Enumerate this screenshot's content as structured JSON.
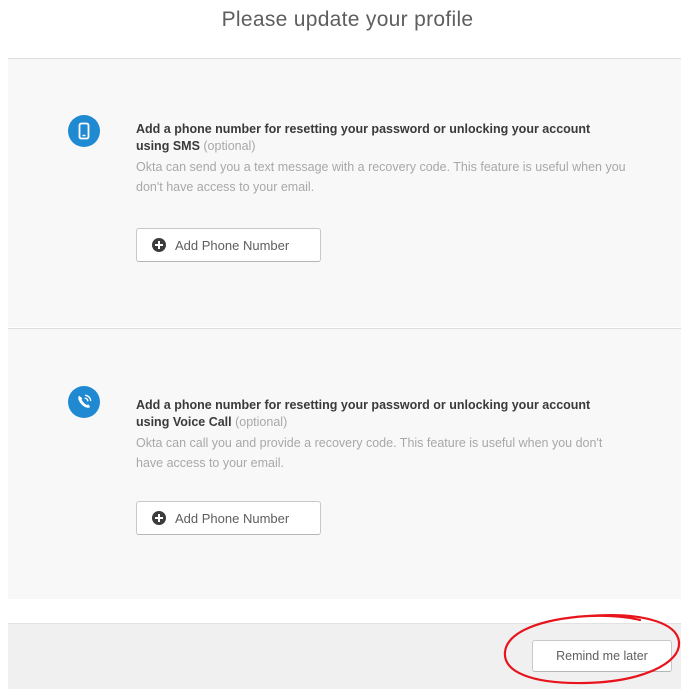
{
  "page": {
    "title": "Please update your profile"
  },
  "factors": [
    {
      "icon": "mobile-phone-icon",
      "title_prefix": "Add a phone number for resetting your password or unlocking your account using ",
      "title_method": "SMS",
      "optional_label": " (optional)",
      "description": "Okta can send you a text message with a recovery code. This feature is useful when you don't have access to your email.",
      "button_label": "Add Phone Number"
    },
    {
      "icon": "voice-call-icon",
      "title_prefix": "Add a phone number for resetting your password or unlocking your account using ",
      "title_method": "Voice Call",
      "optional_label": " (optional)",
      "description": "Okta can call you and provide a recovery code. This feature is useful when you don't have access to your email.",
      "button_label": "Add Phone Number"
    }
  ],
  "footer": {
    "remind_label": "Remind me later"
  },
  "colors": {
    "icon_blue": "#1f8ad2",
    "annotation_red": "#e8141c"
  }
}
